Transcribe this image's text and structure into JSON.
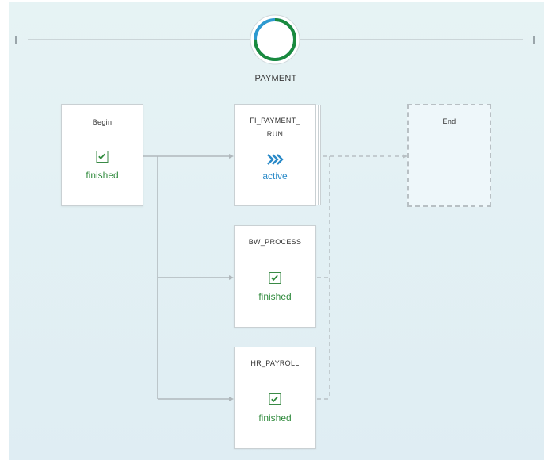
{
  "phase": {
    "label": "PAYMENT",
    "progress": 0.75,
    "colors": {
      "done": "#1a8a3e",
      "remaining": "#2e9ad0",
      "track": "#cfd8dc"
    }
  },
  "nodes": {
    "begin": {
      "title": "Begin",
      "status": "finished",
      "icon": "checkbox-checked-icon"
    },
    "fi_payment_run": {
      "title_line1": "FI_PAYMENT_",
      "title_line2": "RUN",
      "status": "active",
      "icon": "chevron-right-double-icon"
    },
    "bw_process": {
      "title": "BW_PROCESS",
      "status": "finished",
      "icon": "checkbox-checked-icon"
    },
    "hr_payroll": {
      "title": "HR_PAYROLL",
      "status": "finished",
      "icon": "checkbox-checked-icon"
    },
    "end": {
      "title": "End"
    }
  },
  "colors": {
    "finished": "#2f8a3c",
    "active": "#2a8ac8",
    "connector": "#b0b8bc",
    "background": "#e3f0f3"
  }
}
